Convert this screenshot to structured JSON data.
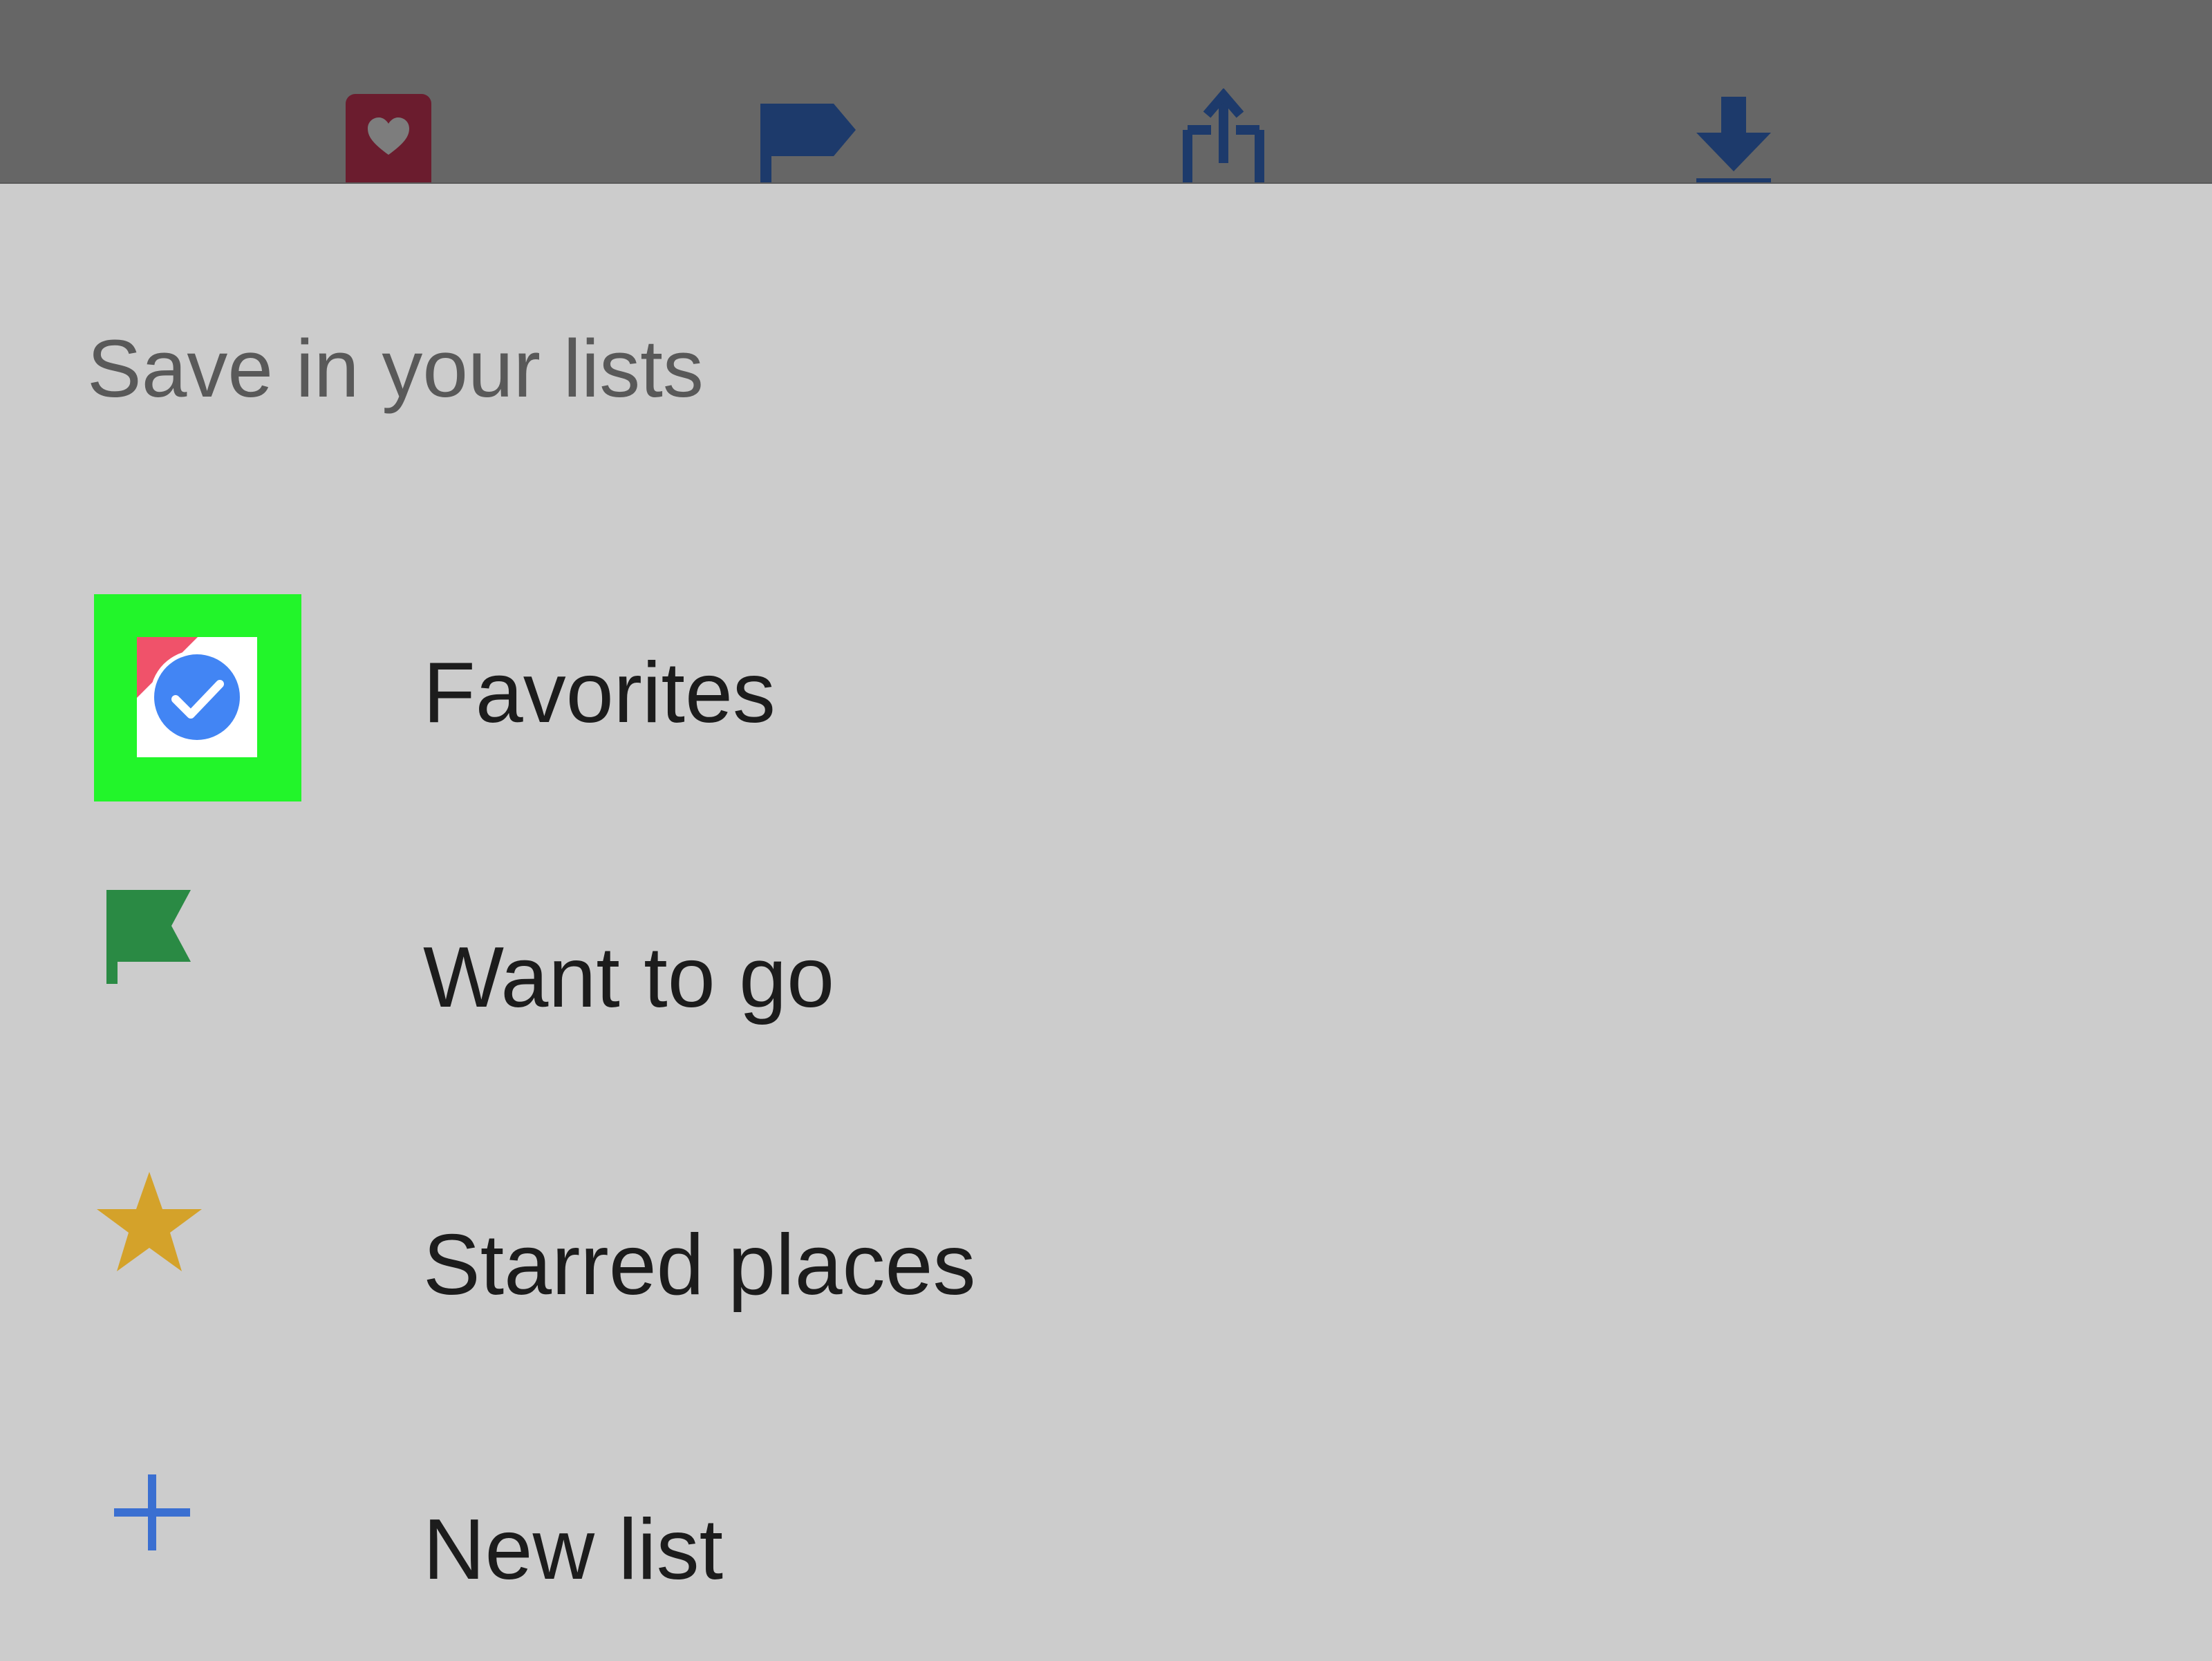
{
  "toolbar": {
    "actions": [
      {
        "name": "save-heart-button",
        "icon": "heart-icon",
        "color": "#6b1c2e"
      },
      {
        "name": "flag-button",
        "icon": "flag-icon",
        "color": "#1d3a6b"
      },
      {
        "name": "share-button",
        "icon": "share-icon",
        "color": "#1d3a6b"
      },
      {
        "name": "download-button",
        "icon": "download-icon",
        "color": "#1d3a6b"
      }
    ]
  },
  "sheet": {
    "title": "Save in your lists",
    "lists": [
      {
        "label": "Favorites",
        "icon": "check-circle-icon",
        "selected": true,
        "accent": "#4285f4",
        "highlight": "#22f52a"
      },
      {
        "label": "Want to go",
        "icon": "flag-icon",
        "accent": "#2a8a44"
      },
      {
        "label": "Starred places",
        "icon": "star-icon",
        "accent": "#d4a22a"
      },
      {
        "label": "New list",
        "icon": "plus-icon",
        "accent": "#3a6fd1"
      }
    ]
  }
}
